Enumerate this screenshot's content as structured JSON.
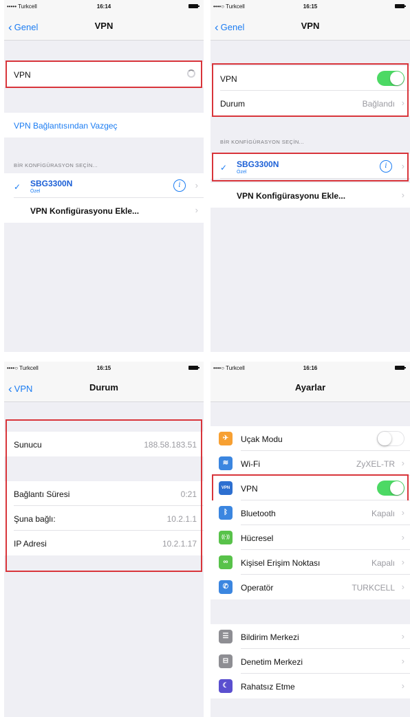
{
  "status": {
    "p1": {
      "carrier": "••••• Turkcell",
      "time": "16:14"
    },
    "p2": {
      "carrier": "••••○ Turkcell",
      "time": "16:15"
    },
    "p3": {
      "carrier": "••••○ Turkcell",
      "time": "16:15"
    },
    "p4": {
      "carrier": "••••○ Turkcell",
      "time": "16:16"
    }
  },
  "p1": {
    "back": "Genel",
    "title": "VPN",
    "vpn_label": "VPN",
    "disconnect": "VPN Bağlantısından Vazgeç",
    "section": "BİR KONFİGÜRASYON SEÇİN...",
    "config_name": "SBG3300N",
    "config_sub": "Özel",
    "add_config": "VPN Konfigürasyonu Ekle..."
  },
  "p2": {
    "back": "Genel",
    "title": "VPN",
    "vpn_label": "VPN",
    "durum_label": "Durum",
    "durum_value": "Bağlandı",
    "section": "BİR KONFİGÜRASYON SEÇİN...",
    "config_name": "SBG3300N",
    "config_sub": "Özel",
    "add_config": "VPN Konfigürasyonu Ekle..."
  },
  "p3": {
    "back": "VPN",
    "title": "Durum",
    "rows": [
      {
        "label": "Sunucu",
        "value": "188.58.183.51"
      },
      {
        "label": "Bağlantı Süresi",
        "value": "0:21"
      },
      {
        "label": "Şuna bağlı:",
        "value": "10.2.1.1"
      },
      {
        "label": "IP Adresi",
        "value": "10.2.1.17"
      }
    ]
  },
  "p4": {
    "title": "Ayarlar",
    "items": [
      {
        "label": "Uçak Modu",
        "icon": "airplane-icon",
        "color": "#f7a032",
        "glyph": "✈"
      },
      {
        "label": "Wi-Fi",
        "value": "ZyXEL-TR",
        "icon": "wifi-icon",
        "color": "#3b86e0",
        "glyph": "≋"
      },
      {
        "label": "VPN",
        "icon": "vpn-icon",
        "color": "#2d6fd0",
        "glyph": "VPN"
      },
      {
        "label": "Bluetooth",
        "value": "Kapalı",
        "icon": "bluetooth-icon",
        "color": "#3b86e0",
        "glyph": "ᛒ"
      },
      {
        "label": "Hücresel",
        "icon": "cellular-icon",
        "color": "#58c24a",
        "glyph": "((·))"
      },
      {
        "label": "Kişisel Erişim Noktası",
        "value": "Kapalı",
        "icon": "hotspot-icon",
        "color": "#58c24a",
        "glyph": "∞"
      },
      {
        "label": "Operatör",
        "value": "TURKCELL",
        "icon": "phone-icon",
        "color": "#3b86e0",
        "glyph": "✆"
      },
      {
        "label": "Bildirim Merkezi",
        "icon": "notification-center-icon",
        "color": "#8e8e93",
        "glyph": "☰"
      },
      {
        "label": "Denetim Merkezi",
        "icon": "control-center-icon",
        "color": "#8e8e93",
        "glyph": "⊟"
      },
      {
        "label": "Rahatsız Etme",
        "icon": "do-not-disturb-icon",
        "color": "#5a4fcf",
        "glyph": "☾"
      }
    ]
  }
}
